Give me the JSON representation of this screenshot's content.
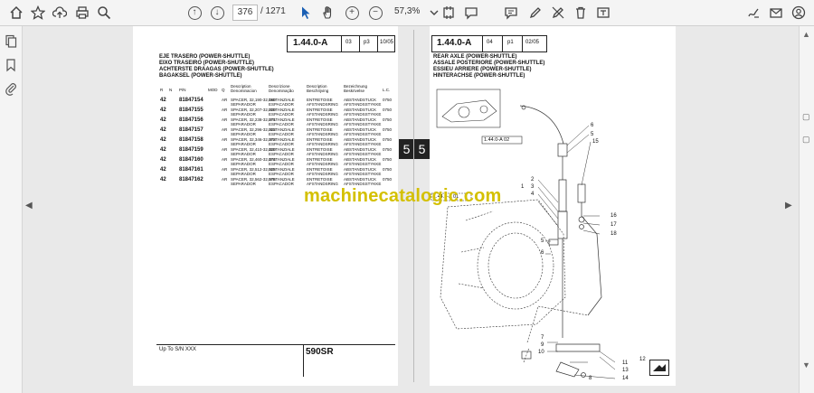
{
  "toolbar": {
    "current_page": "376",
    "total_pages": "/ 1271",
    "zoom": "57,3%"
  },
  "left_page": {
    "ref_code": "1.44.0-A",
    "ref_num": "03",
    "ref_page": "p3",
    "ref_date": "10/05",
    "titles": [
      "EJE TRASERO (POWER-SHUTTLE)",
      "EIXO TRASEIRO (POWER-SHUTTLE)",
      "ACHTERSTE DRAAGAS (POWER-SHUTTLE)",
      "BAGAKSEL (POWER-SHUTTLE)"
    ],
    "columns": [
      "R",
      "N",
      "P/N",
      "MOD",
      "Q",
      "Description Denominacion",
      "Descrizione Denominação",
      "Description Beschrijving",
      "Bezeichnung Beskrivelse",
      "L.C."
    ],
    "rows": [
      {
        "r": "42",
        "pn": "81847154",
        "q": "AR",
        "d1": "SPACER, 32,190-32,160",
        "d1b": "SEPARADOR",
        "d2": "DISTANZIALE",
        "d2b": "ESPACADOR",
        "d3": "ENTRETOISE",
        "d3b": "AFSTANDSRING",
        "d4": "ABSTANDSTUCK",
        "d4b": "AFSTANDSSTYKKE",
        "lc": "0750"
      },
      {
        "r": "42",
        "pn": "81847155",
        "q": "AR",
        "d1": "SPACER, 32,207-32,220",
        "d1b": "SEPARADOR",
        "d2": "DISTANZIALE",
        "d2b": "ESPACADOR",
        "d3": "ENTRETOISE",
        "d3b": "AFSTANDSRING",
        "d4": "ABSTANDSTUCK",
        "d4b": "AFSTANDSSTYKKE",
        "lc": "0750"
      },
      {
        "r": "42",
        "pn": "81847156",
        "q": "AR",
        "d1": "SPACER, 32,238-32,271",
        "d1b": "SEPARADOR",
        "d2": "DISTANZIALE",
        "d2b": "ESPACADOR",
        "d3": "ENTRETOISE",
        "d3b": "AFSTANDSRING",
        "d4": "ABSTANDSTUCK",
        "d4b": "AFSTANDSSTYKKE",
        "lc": "0750"
      },
      {
        "r": "42",
        "pn": "81847157",
        "q": "AR",
        "d1": "SPACER, 32,296-32,322",
        "d1b": "SEPARADOR",
        "d2": "DISTANZIALE",
        "d2b": "ESPACADOR",
        "d3": "ENTRETOISE",
        "d3b": "AFSTANDSRING",
        "d4": "ABSTANDSTUCK",
        "d4b": "AFSTANDSSTYKKE",
        "lc": "0750"
      },
      {
        "r": "42",
        "pn": "81847158",
        "q": "AR",
        "d1": "SPACER, 32,346-32,373",
        "d1b": "SEPARADOR",
        "d2": "DISTANZIALE",
        "d2b": "ESPACADOR",
        "d3": "ENTRETOISE",
        "d3b": "AFSTANDSRING",
        "d4": "ABSTANDSTUCK",
        "d4b": "AFSTANDSSTYKKE",
        "lc": "0750"
      },
      {
        "r": "42",
        "pn": "81847159",
        "q": "AR",
        "d1": "SPACER, 32,410-32,420",
        "d1b": "SEPARADOR",
        "d2": "DISTANZIALE",
        "d2b": "ESPACADOR",
        "d3": "ENTRETOISE",
        "d3b": "AFSTANDSRING",
        "d4": "ABSTANDSTUCK",
        "d4b": "AFSTANDSSTYKKE",
        "lc": "0750"
      },
      {
        "r": "42",
        "pn": "81847160",
        "q": "AR",
        "d1": "SPACER, 32,460-32,474",
        "d1b": "SEPARADOR",
        "d2": "DISTANZIALE",
        "d2b": "ESPACADOR",
        "d3": "ENTRETOISE",
        "d3b": "AFSTANDSRING",
        "d4": "ABSTANDSTUCK",
        "d4b": "AFSTANDSSTYKKE",
        "lc": "0750"
      },
      {
        "r": "42",
        "pn": "81847161",
        "q": "AR",
        "d1": "SPACER, 32,512-32,525",
        "d1b": "SEPARADOR",
        "d2": "DISTANZIALE",
        "d2b": "ESPACADOR",
        "d3": "ENTRETOISE",
        "d3b": "AFSTANDSRING",
        "d4": "ABSTANDSTUCK",
        "d4b": "AFSTANDSSTYKKE",
        "lc": "0750"
      },
      {
        "r": "42",
        "pn": "81847162",
        "q": "AR",
        "d1": "SPACER, 32,562-32,576",
        "d1b": "SEPARADOR",
        "d2": "DISTANZIALE",
        "d2b": "ESPACADOR",
        "d3": "ENTRETOISE",
        "d3b": "AFSTANDSRING",
        "d4": "ABSTANDSTUCK",
        "d4b": "AFSTANDSSTYKKE",
        "lc": "0750"
      }
    ],
    "footer_note": "Up To S/N XXX",
    "model": "590SR"
  },
  "center_mark": {
    "left": "5",
    "right": "5"
  },
  "right_page": {
    "ref_code": "1.44.0-A",
    "ref_num": "04",
    "ref_page": "p1",
    "ref_date": "02/05",
    "titles": [
      "REAR AXLE (POWER-SHUTTLE)",
      "ASSALE POSTERIORE (POWER-SHUTTLE)",
      "ESSIEU ARRIERE (POWER-SHUTTLE)",
      "HINTERACHSE (POWER-SHUTTLE)"
    ],
    "ref_box_1": "1.44.0-A 02",
    "ref_box_2": "1.44.0-A 01",
    "callouts": [
      "6",
      "5",
      "15",
      "2",
      "1",
      "3",
      "4",
      "16",
      "17",
      "18",
      "5",
      "6",
      "7",
      "9",
      "10",
      "11",
      "12",
      "13",
      "8",
      "14"
    ]
  },
  "watermark": "machinecatalogic.com",
  "colors": {
    "watermark": "#d4c000",
    "toolbar": "#f4f4f4",
    "viewer_bg": "#e9e9e9"
  }
}
